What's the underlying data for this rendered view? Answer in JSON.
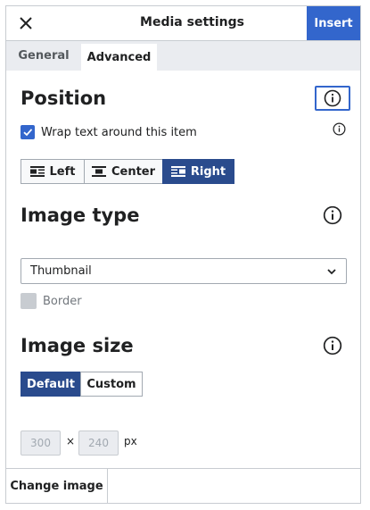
{
  "header": {
    "title": "Media settings",
    "insert_label": "Insert"
  },
  "tabs": [
    {
      "label": "General"
    },
    {
      "label": "Advanced"
    }
  ],
  "position": {
    "title": "Position",
    "wrap_label": "Wrap text around this item",
    "wrap_checked": true,
    "align_options": [
      {
        "label": "Left"
      },
      {
        "label": "Center"
      },
      {
        "label": "Right"
      }
    ],
    "align_selected": "Right"
  },
  "image_type": {
    "title": "Image type",
    "selected": "Thumbnail",
    "border_label": "Border",
    "border_checked": false
  },
  "image_size": {
    "title": "Image size",
    "options": [
      {
        "label": "Default"
      },
      {
        "label": "Custom"
      }
    ],
    "selected": "Default",
    "width_value": "300",
    "height_value": "240",
    "separator": "×",
    "unit": "px"
  },
  "footer": {
    "change_image_label": "Change image"
  },
  "colors": {
    "accent": "#3366cc",
    "active_segment": "#2a4b8d",
    "tab_bar": "#eaecf0",
    "border": "#c8ccd1"
  },
  "icons": {
    "close": "close-icon",
    "info": "info-icon",
    "chevron": "chevron-down-icon",
    "check": "check-icon"
  }
}
